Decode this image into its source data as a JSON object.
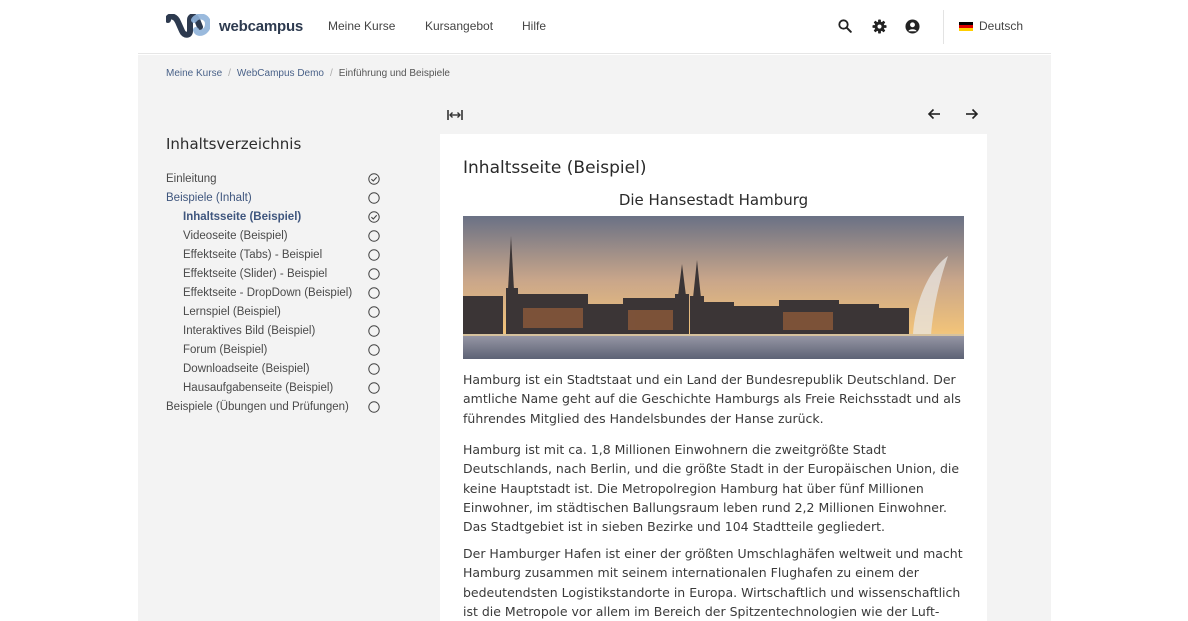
{
  "header": {
    "logo_text": "webcampus",
    "nav": [
      "Meine Kurse",
      "Kursangebot",
      "Hilfe"
    ],
    "icons": [
      "search-icon",
      "settings-gear-icon",
      "user-account-icon"
    ],
    "language": "Deutsch",
    "flag_colors": [
      "#000000",
      "#dd0000",
      "#ffce00"
    ]
  },
  "breadcrumb": [
    "Meine Kurse",
    "WebCampus Demo",
    "Einführung und Beispiele"
  ],
  "toc": {
    "title": "Inhaltsverzeichnis",
    "items": [
      {
        "label": "Einleitung",
        "status": "done"
      },
      {
        "label": "Beispiele (Inhalt)",
        "status": "open"
      },
      {
        "label": "Inhaltsseite (Beispiel)",
        "status": "done"
      },
      {
        "label": "Videoseite (Beispiel)",
        "status": "open"
      },
      {
        "label": "Effektseite (Tabs) - Beispiel",
        "status": "open"
      },
      {
        "label": "Effektseite (Slider) - Beispiel",
        "status": "open"
      },
      {
        "label": "Effektseite - DropDown (Beispiel)",
        "status": "open"
      },
      {
        "label": "Lernspiel (Beispiel)",
        "status": "open"
      },
      {
        "label": "Interaktives Bild (Beispiel)",
        "status": "open"
      },
      {
        "label": "Forum (Beispiel)",
        "status": "open"
      },
      {
        "label": "Downloadseite (Beispiel)",
        "status": "open"
      },
      {
        "label": "Hausaufgabenseite (Beispiel)",
        "status": "open"
      },
      {
        "label": "Beispiele (Übungen und Prüfungen)",
        "status": "open"
      }
    ]
  },
  "content": {
    "page_title": "Inhaltsseite (Beispiel)",
    "subtitle": "Die Hansestadt Hamburg",
    "paragraphs": [
      "Hamburg ist ein Stadtstaat und ein Land der Bundesrepublik Deutschland. Der amtliche Name geht auf die Geschichte Hamburgs als Freie Reichsstadt und als führendes Mitglied des Handelsbundes der Hanse zurück.",
      "Hamburg ist mit ca. 1,8 Millionen Einwohnern die zweitgrößte Stadt Deutschlands, nach Berlin, und die größte Stadt in der Europäischen Union, die keine Hauptstadt ist. Die Metropolregion Hamburg hat über fünf Millionen Einwohner, im städtischen Ballungsraum leben rund 2,2 Millionen Einwohner. Das Stadtgebiet ist in sieben Bezirke und 104 Stadtteile gegliedert.",
      "Der Hamburger Hafen ist einer der größten Umschlaghäfen weltweit und macht Hamburg zusammen mit seinem internationalen Flughafen zu einem der bedeutendsten Logistikstandorte in Europa. Wirtschaftlich und wissenschaftlich ist die Metropole vor allem im Bereich der Spitzentechnologien wie der Luft- und"
    ]
  },
  "colors": {
    "accent": "#3f567e",
    "page_bg": "#f3f3f3",
    "card_bg": "#ffffff"
  }
}
